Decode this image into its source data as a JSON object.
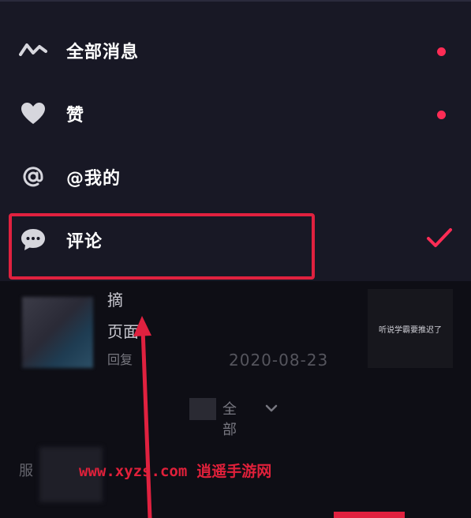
{
  "menu": {
    "items": [
      {
        "label": "全部消息",
        "icon": "activity-wave-icon",
        "has_dot": true
      },
      {
        "label": "赞",
        "icon": "heart-icon",
        "has_dot": true
      },
      {
        "label": "@我的",
        "icon": "at-icon",
        "has_dot": false
      },
      {
        "label": "评论",
        "icon": "comment-bubble-icon",
        "selected": true
      }
    ]
  },
  "content": {
    "fragment_1": "摘",
    "fragment_2": "页面",
    "fragment_3": "回复",
    "date": "2020-08-23",
    "video_caption": "听说学霸要推迟了",
    "filter_label": "全部",
    "fragment_4": "服"
  },
  "watermark": {
    "url": "www.xyzs.com",
    "name": "逍遥手游网"
  },
  "colors": {
    "accent": "#fe2c55",
    "highlight": "#e0213f",
    "menu_bg": "#181825",
    "page_bg": "#0e0e15"
  }
}
